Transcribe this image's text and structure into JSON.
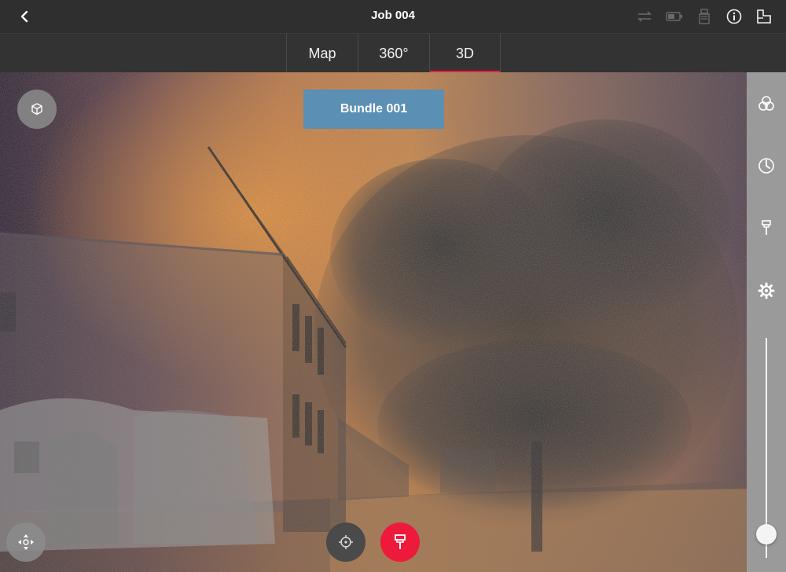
{
  "header": {
    "title": "Job 004",
    "icons": [
      "back-chevron-icon",
      "sync-icon",
      "battery-icon",
      "device-icon",
      "info-icon",
      "floorplan-icon"
    ]
  },
  "tabs": [
    {
      "label": "Map",
      "active": false
    },
    {
      "label": "360°",
      "active": false
    },
    {
      "label": "3D",
      "active": true
    }
  ],
  "viewport": {
    "bundle_label": "Bundle 001",
    "buttons": [
      "cube-view-icon",
      "move-icon",
      "crosshair-icon",
      "pin-icon"
    ]
  },
  "rail": {
    "icons": [
      "layers-icon",
      "compass-icon",
      "pin-icon",
      "settings-icon"
    ],
    "slider_value": 0.07
  },
  "colors": {
    "accent": "#ff1f3d",
    "bundle_banner": "#5b8fb4",
    "rail": "#9a9a9a"
  }
}
